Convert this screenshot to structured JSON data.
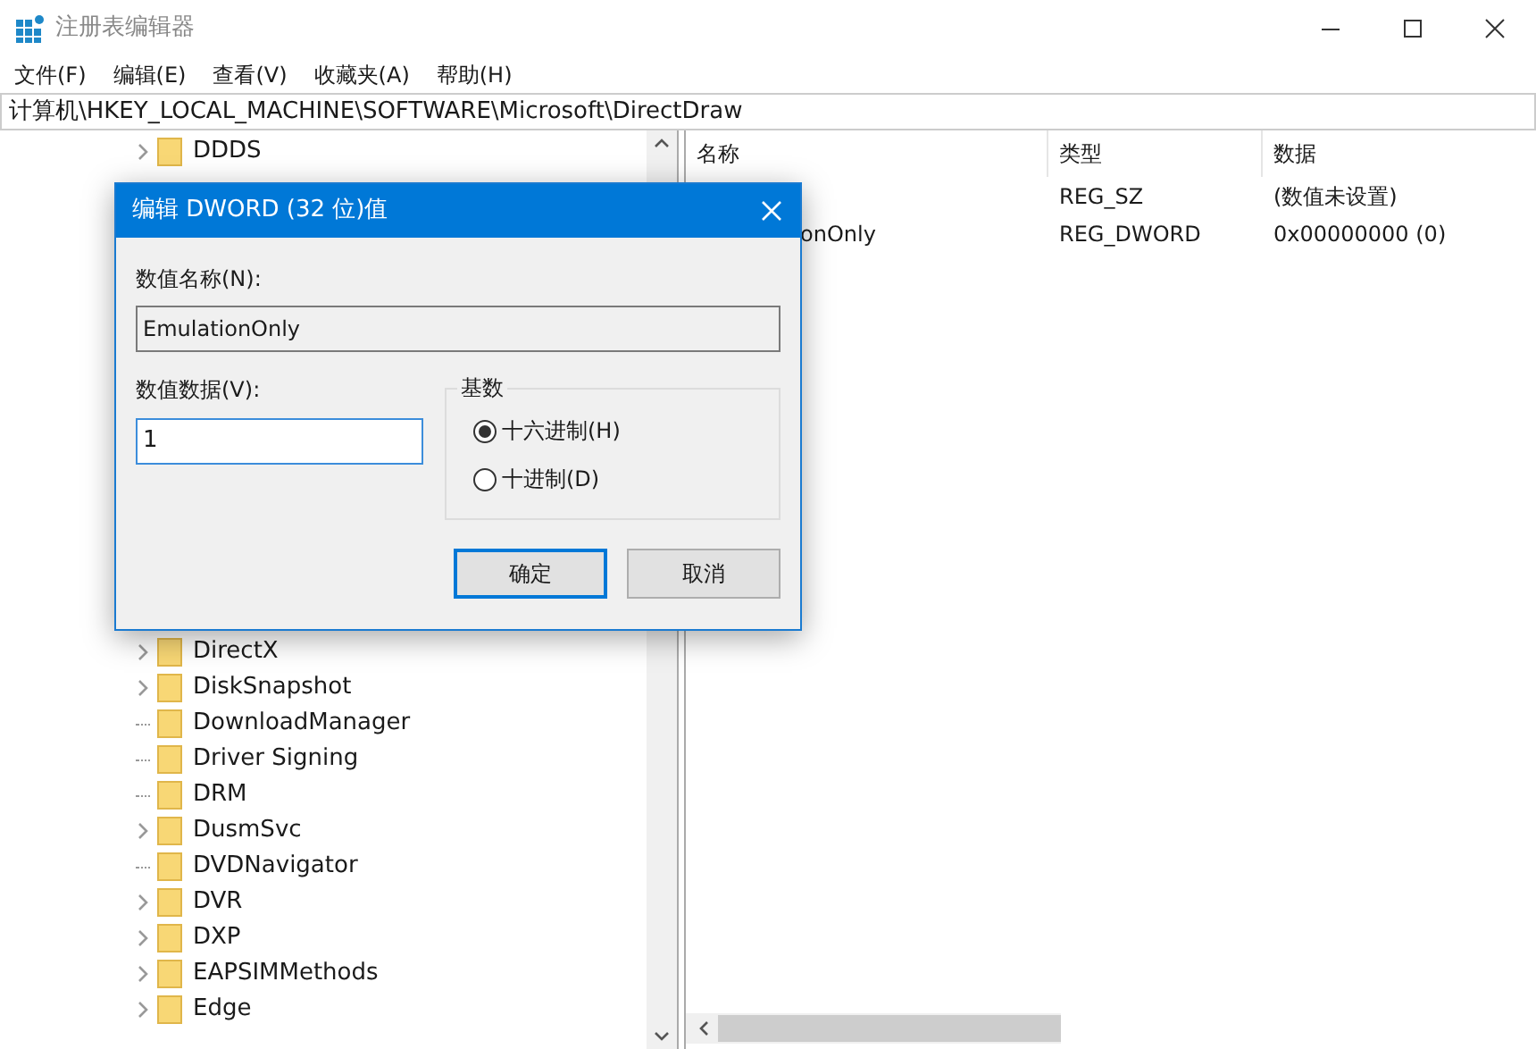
{
  "window": {
    "title": "注册表编辑器"
  },
  "menu": [
    "文件(F)",
    "编辑(E)",
    "查看(V)",
    "收藏夹(A)",
    "帮助(H)"
  ],
  "address": "计算机\\HKEY_LOCAL_MACHINE\\SOFTWARE\\Microsoft\\DirectDraw",
  "tree_top": [
    {
      "label": "DDDS",
      "expandable": true
    }
  ],
  "tree": [
    {
      "label": "DirectX",
      "expandable": true
    },
    {
      "label": "DiskSnapshot",
      "expandable": true
    },
    {
      "label": "DownloadManager",
      "expandable": false
    },
    {
      "label": "Driver Signing",
      "expandable": false
    },
    {
      "label": "DRM",
      "expandable": false
    },
    {
      "label": "DusmSvc",
      "expandable": true
    },
    {
      "label": "DVDNavigator",
      "expandable": false
    },
    {
      "label": "DVR",
      "expandable": true
    },
    {
      "label": "DXP",
      "expandable": true
    },
    {
      "label": "EAPSIMMethods",
      "expandable": true
    },
    {
      "label": "Edge",
      "expandable": true
    }
  ],
  "values": {
    "columns": [
      "名称",
      "类型",
      "数据"
    ],
    "rows": [
      {
        "type": "REG_SZ",
        "data": "(数值未设置)"
      },
      {
        "name": "onOnly",
        "type": "REG_DWORD",
        "data": "0x00000000 (0)"
      }
    ]
  },
  "dialog": {
    "title": "编辑 DWORD (32 位)值",
    "name_label": "数值名称(N):",
    "name_value": "EmulationOnly",
    "data_label": "数值数据(V):",
    "data_value": "1",
    "base_label": "基数",
    "radios": [
      {
        "label": "十六进制(H)",
        "selected": true
      },
      {
        "label": "十进制(D)",
        "selected": false
      }
    ],
    "buttons": [
      {
        "label": "确定",
        "default": true
      },
      {
        "label": "取消",
        "default": false
      }
    ]
  }
}
